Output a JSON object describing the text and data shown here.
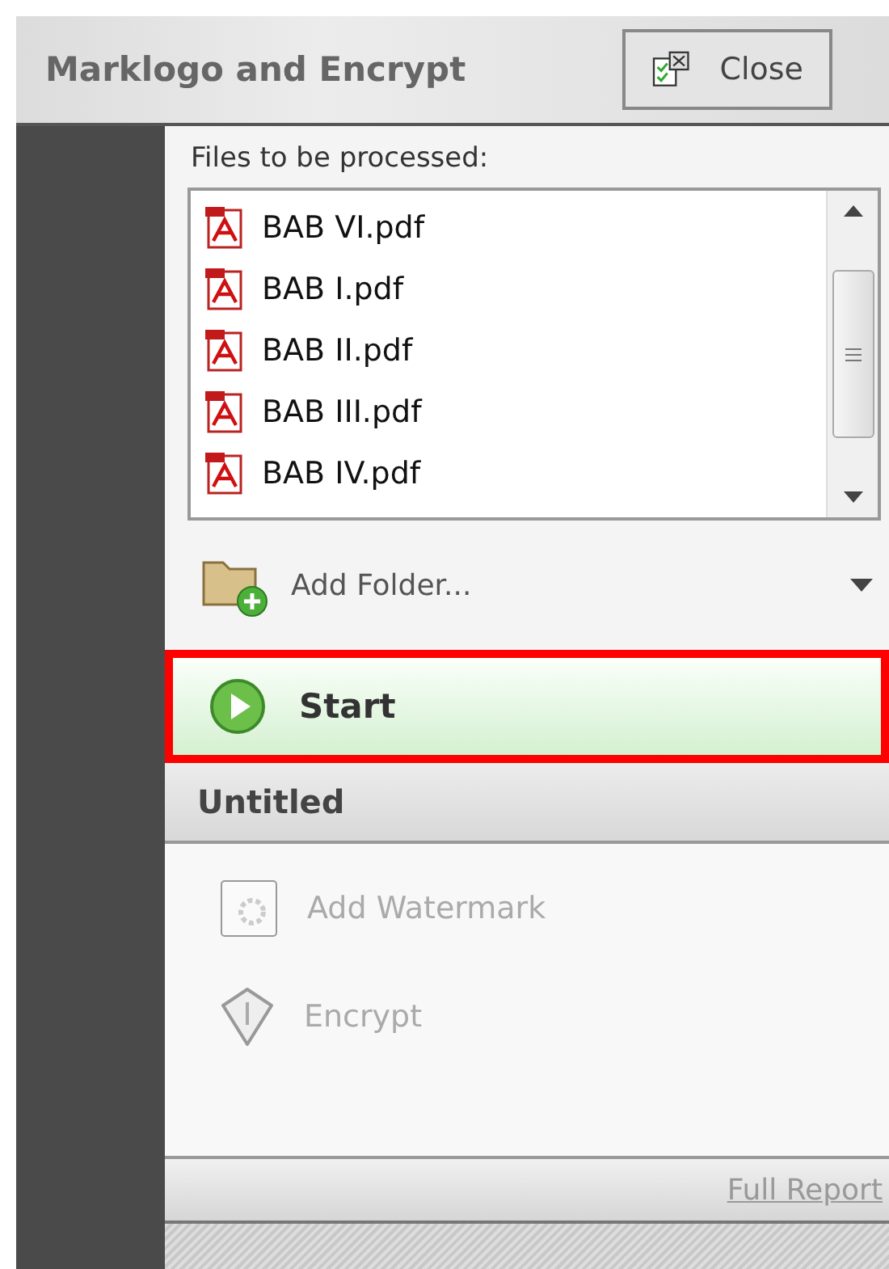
{
  "header": {
    "title": "Marklogo and Encrypt",
    "close_button": "Close"
  },
  "files": {
    "label": "Files to be processed:",
    "items": [
      {
        "name": "BAB VI.pdf"
      },
      {
        "name": "BAB I.pdf"
      },
      {
        "name": "BAB II.pdf"
      },
      {
        "name": "BAB III.pdf"
      },
      {
        "name": "BAB IV.pdf"
      }
    ]
  },
  "add_folder": {
    "label": "Add Folder..."
  },
  "start": {
    "label": "Start",
    "highlighted": true
  },
  "section": {
    "title": "Untitled"
  },
  "actions": [
    {
      "kind": "watermark",
      "label": "Add Watermark",
      "disabled": true
    },
    {
      "kind": "encrypt",
      "label": "Encrypt",
      "disabled": true
    }
  ],
  "footer": {
    "link": "Full Report"
  }
}
